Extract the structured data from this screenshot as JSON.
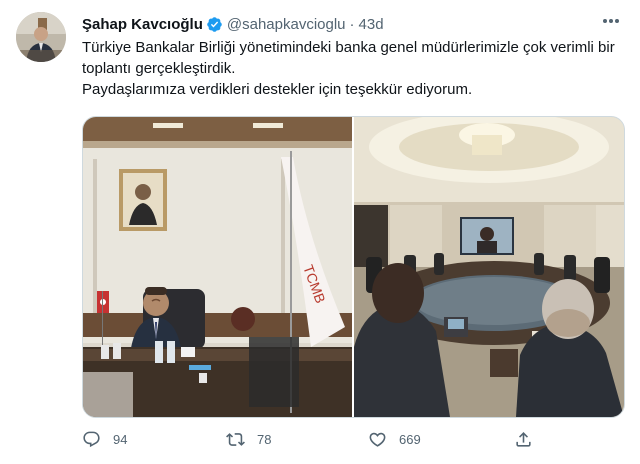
{
  "tweet": {
    "author_name": "Şahap Kavcıoğlu",
    "handle": "@sahapkavcioglu",
    "separator": "·",
    "time": "43d",
    "text_lines": [
      "Türkiye Bankalar Birliği yönetimindeki banka genel müdürlerimizle çok verimli bir toplantı gerçekleştirdik.",
      "Paydaşlarımıza verdikleri destekler için teşekkür ediyorum."
    ],
    "photos": [
      {
        "flag_text": "TCMB"
      },
      {}
    ],
    "actions": {
      "reply_count": "94",
      "retweet_count": "78",
      "like_count": "669"
    }
  },
  "icons": {
    "verified": "verified-badge-icon",
    "more": "more-options-icon",
    "reply": "reply-icon",
    "retweet": "retweet-icon",
    "like": "like-icon",
    "share": "share-icon"
  },
  "colors": {
    "verified_blue": "#1d9bf0",
    "secondary_text": "#536471",
    "border": "#cfd9de"
  }
}
